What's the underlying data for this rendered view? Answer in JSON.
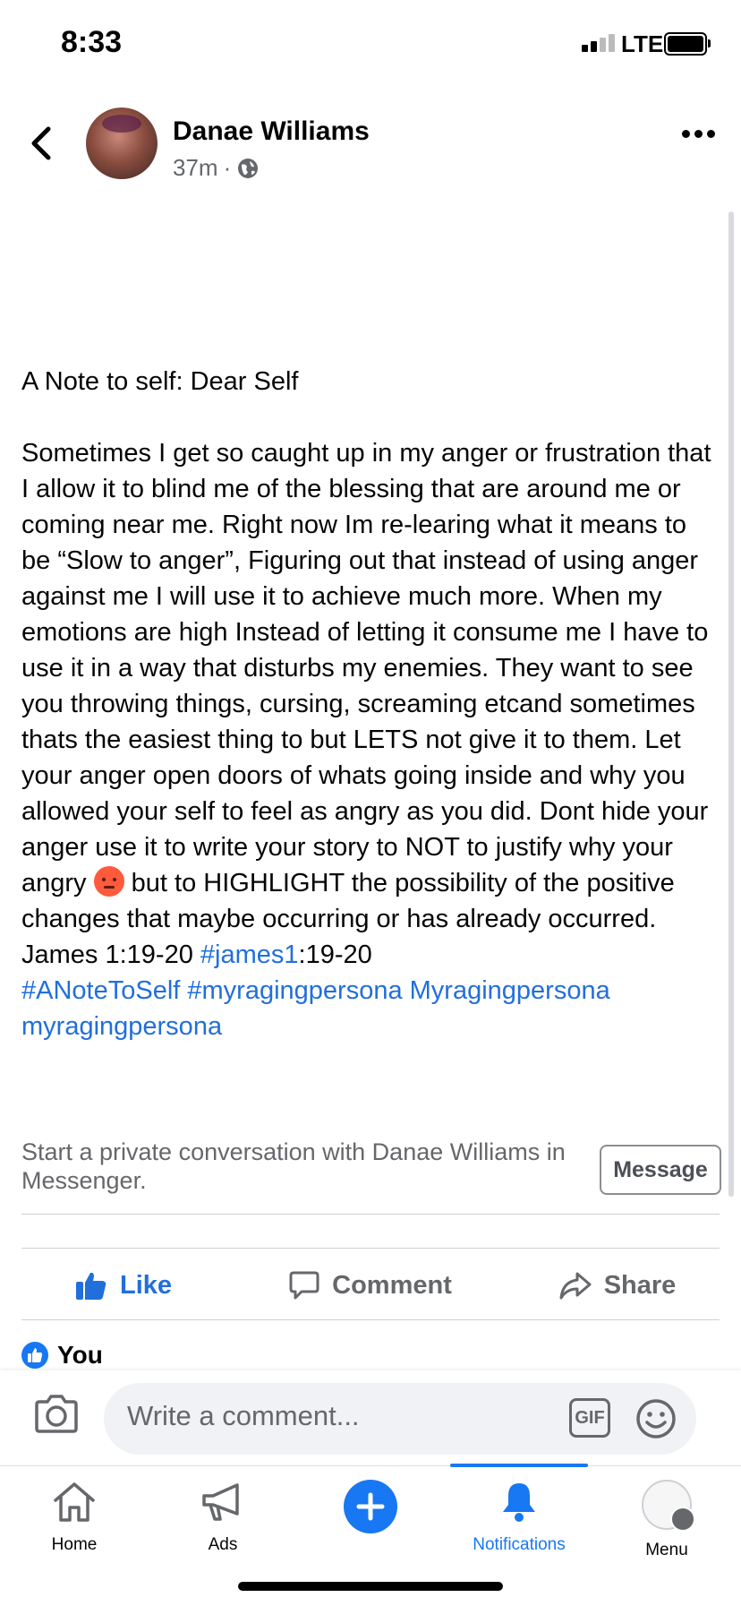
{
  "status_bar": {
    "time": "8:33",
    "network": "LTE"
  },
  "post": {
    "author": "Danae Williams",
    "age": "37m",
    "separator": "·",
    "title_line": "A Note to self: Dear Self",
    "body": "Sometimes I get so caught up in my anger or frustration that I allow it to blind me of the blessing that are around me or coming near me. Right now Im re-learing what it means to be “Slow to anger”, Figuring out that instead of using anger against me I will use it to achieve much more. When my emotions are high Instead of letting it consume me I have to use it in a way that disturbs my enemies. They want to see you throwing things, cursing, screaming etcand sometimes thats the easiest thing to but LETS not give it to them. Let your anger open doors of whats going inside and why you allowed your self to feel as angry as you did. Dont hide your anger use it to write your story to NOT to justify why your angry",
    "body_after_emoji": "but to HIGHLIGHT the possibility of the positive changes that maybe occurring or has already occurred.",
    "verse_prefix": "James 1:19-20 ",
    "verse_hashtag": "#james1",
    "verse_suffix": ":19-20",
    "hashtags_line1": "#ANoteToSelf #myragingpersona Myragingpersona",
    "hashtags_line2": "myragingpersona"
  },
  "messenger": {
    "prompt": "Start a private conversation with Danae Williams in Messenger.",
    "button": "Message"
  },
  "actions": {
    "like": "Like",
    "comment": "Comment",
    "share": "Share"
  },
  "reactions": {
    "label": "You"
  },
  "composer": {
    "placeholder": "Write a comment...",
    "gif": "GIF"
  },
  "nav": {
    "home": "Home",
    "ads": "Ads",
    "notifications": "Notifications",
    "menu": "Menu",
    "active_color": "#1877f2"
  },
  "colors": {
    "link": "#216fdb",
    "brand": "#1877f2",
    "secondary_text": "#65676b"
  }
}
